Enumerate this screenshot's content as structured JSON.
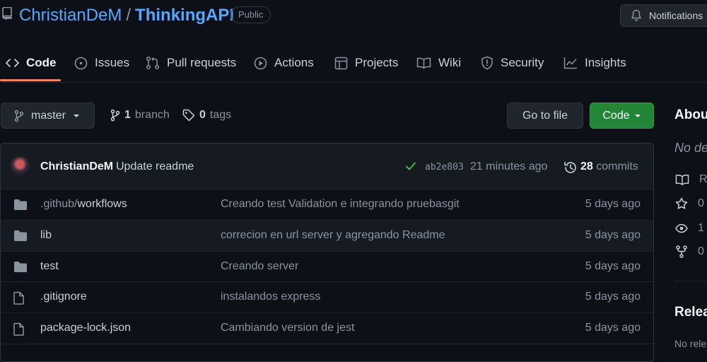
{
  "repo": {
    "owner": "ChristianDeM",
    "separator": "/",
    "name": "ThinkingAPI",
    "visibility": "Public"
  },
  "header": {
    "notifications_label": "Notifications"
  },
  "tabs": [
    {
      "label": "Code",
      "icon": "code-icon",
      "selected": true
    },
    {
      "label": "Issues",
      "icon": "issue-icon",
      "selected": false
    },
    {
      "label": "Pull requests",
      "icon": "pull-request-icon",
      "selected": false
    },
    {
      "label": "Actions",
      "icon": "play-icon",
      "selected": false
    },
    {
      "label": "Projects",
      "icon": "table-icon",
      "selected": false
    },
    {
      "label": "Wiki",
      "icon": "book-icon",
      "selected": false
    },
    {
      "label": "Security",
      "icon": "shield-icon",
      "selected": false
    },
    {
      "label": "Insights",
      "icon": "graph-icon",
      "selected": false
    }
  ],
  "branch_bar": {
    "branch": "master",
    "branch_count": "1",
    "branch_label": "branch",
    "tag_count": "0",
    "tag_label": "tags",
    "goto_file": "Go to file",
    "code_button": "Code"
  },
  "latest_commit": {
    "author": "ChristianDeM",
    "message": "Update readme",
    "sha": "ab2e803",
    "time": "21 minutes ago",
    "commit_count": "28",
    "commit_label": "commits"
  },
  "files": [
    {
      "type": "folder",
      "name_dim": ".github/",
      "name": "workflows",
      "message": "Creando test Validation e integrando pruebasgit",
      "age": "5 days ago"
    },
    {
      "type": "folder",
      "name_dim": "",
      "name": "lib",
      "message": "correcion en url server y agregando Readme",
      "age": "5 days ago"
    },
    {
      "type": "folder",
      "name_dim": "",
      "name": "test",
      "message": "Creando server",
      "age": "5 days ago"
    },
    {
      "type": "file",
      "name_dim": "",
      "name": ".gitignore",
      "message": "instalandos express",
      "age": "5 days ago"
    },
    {
      "type": "file",
      "name_dim": "",
      "name": "package-lock.json",
      "message": "Cambiando version de jest",
      "age": "5 days ago"
    }
  ],
  "sidebar": {
    "about_title": "About",
    "about_desc": "No de",
    "items": [
      {
        "icon": "book-icon",
        "text": "R"
      },
      {
        "icon": "star-icon",
        "text": "0"
      },
      {
        "icon": "eye-icon",
        "text": "1"
      },
      {
        "icon": "fork-icon",
        "text": "0"
      }
    ],
    "releases_title": "Relea",
    "releases_desc": "No rele"
  },
  "colors": {
    "background": "#0d1117",
    "link": "#58a6ff",
    "accent_underline": "#f78166",
    "primary_button": "#238636",
    "success_check": "#3fb950"
  }
}
